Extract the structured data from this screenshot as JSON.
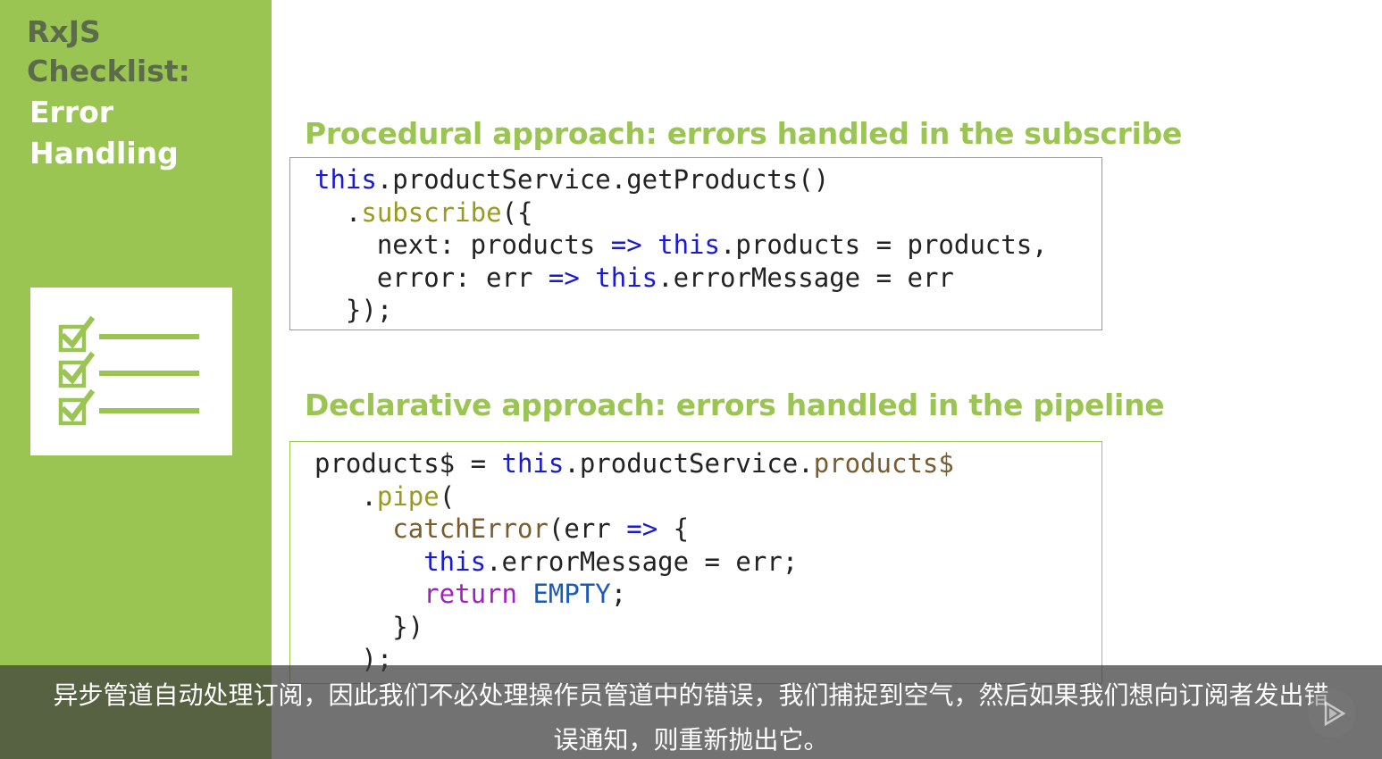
{
  "sidebar": {
    "title_line1": "RxJS",
    "title_line2": "Checklist:",
    "title_line3": "Error",
    "title_line4": "Handling",
    "icon": "checklist-icon"
  },
  "procedural": {
    "heading": "Procedural approach: errors handled in the subscribe",
    "code": {
      "l1a": "this",
      "l1b": ".productService.getProducts()",
      "l2a": "  .",
      "l2b": "subscribe",
      "l2c": "({",
      "l3a": "    next: products ",
      "l3b": "=>",
      "l3c": " ",
      "l3d": "this",
      "l3e": ".products = products,",
      "l4a": "    error: err ",
      "l4b": "=>",
      "l4c": " ",
      "l4d": "this",
      "l4e": ".errorMessage = err",
      "l5": "  });"
    }
  },
  "declarative": {
    "heading": "Declarative approach: errors handled in the pipeline",
    "code": {
      "l1a": "products$ = ",
      "l1b": "this",
      "l1c": ".productService.",
      "l1d": "products$",
      "l2a": "   .",
      "l2b": "pipe",
      "l2c": "(",
      "l3a": "     ",
      "l3b": "catchError",
      "l3c": "(err ",
      "l3d": "=>",
      "l3e": " {",
      "l4a": "       ",
      "l4b": "this",
      "l4c": ".errorMessage = err;",
      "l5a": "       ",
      "l5b": "return",
      "l5c": " ",
      "l5d": "EMPTY",
      "l5e": ";",
      "l6": "     })",
      "l7": "   );"
    }
  },
  "subtitle": {
    "line1": "异步管道自动处理订阅，因此我们不必处理操作员管道中的错误，我们捕捉到空气，然后如果我们想向订阅者发出错",
    "line2": "误通知，则重新抛出它。"
  },
  "player": {
    "play_icon": "play-icon"
  },
  "colors": {
    "accent_green": "#9bc552",
    "keyword_blue": "#1a1ad0",
    "method_olive": "#9a9a20",
    "return_purple": "#a020c0"
  }
}
